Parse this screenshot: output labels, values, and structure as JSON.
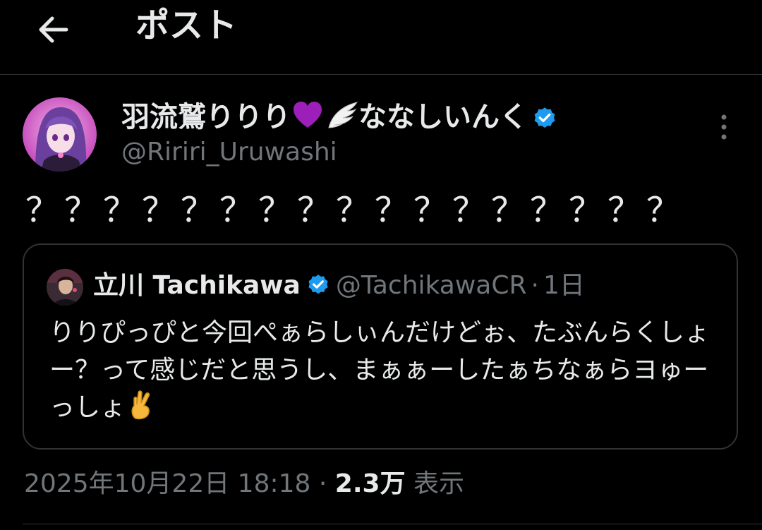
{
  "header": {
    "title": "ポスト",
    "back_icon": "arrow-left-icon"
  },
  "post": {
    "author_name": "羽流鷲りりり",
    "author_name_suffix": "ななしいんく",
    "author_handle": "@Ririri_Uruwashi",
    "verified": true,
    "text": "？？？？？？？？？？？？？？？？？",
    "more_icon": "more-vertical-icon",
    "emoji_heart": "purple-heart-icon",
    "emoji_wing": "wing-icon"
  },
  "quote": {
    "author_name": "立川 Tachikawa",
    "author_handle": "@TachikawaCR",
    "separator": "·",
    "time": "1日",
    "verified": true,
    "text": "りりぴっぴと今回ぺぁらしぃんだけどぉ、たぶんらくしょー？って感じだと思うし、まぁぁーしたぁちなぁらヨゅーっしょ",
    "emoji": "crossed-fingers-icon"
  },
  "meta": {
    "timestamp": "2025年10月22日 18:18",
    "separator": "·",
    "views_count": "2.3万",
    "views_label": "表示"
  },
  "colors": {
    "background": "#000000",
    "text": "#e7e9ea",
    "secondary": "#71767b",
    "border": "#2f3336",
    "verified": "#1d9bf0",
    "heart": "#9b1fb8"
  }
}
